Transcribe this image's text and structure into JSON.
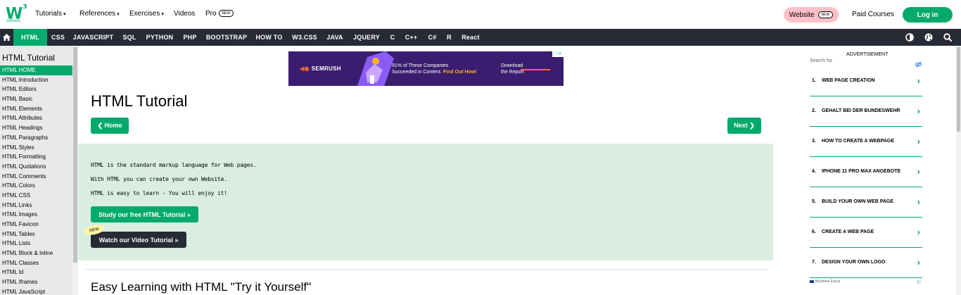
{
  "topbar": {
    "logo_main": "W",
    "logo_sup": "3",
    "logo_sub": "schools",
    "nav": [
      {
        "label": "Tutorials",
        "caret": "▾"
      },
      {
        "label": "References",
        "caret": "▾"
      },
      {
        "label": "Exercises",
        "caret": "▾"
      },
      {
        "label": "Videos"
      },
      {
        "label": "Pro",
        "badge": "NEW"
      }
    ],
    "website_label": "Website",
    "website_badge": "NEW",
    "paid_courses": "Paid Courses",
    "login": "Log in"
  },
  "navbar": {
    "tabs": [
      "HTML",
      "CSS",
      "JAVASCRIPT",
      "SQL",
      "PYTHON",
      "PHP",
      "BOOTSTRAP",
      "HOW TO",
      "W3.CSS",
      "JAVA",
      "JQUERY",
      "C",
      "C++",
      "C#",
      "R",
      "React"
    ],
    "active_tab": "HTML",
    "icons": [
      "home-icon",
      "contrast-icon",
      "globe-icon",
      "search-icon"
    ]
  },
  "sidebar": {
    "title": "HTML Tutorial",
    "links": [
      "HTML HOME",
      "HTML Introduction",
      "HTML Editors",
      "HTML Basic",
      "HTML Elements",
      "HTML Attributes",
      "HTML Headings",
      "HTML Paragraphs",
      "HTML Styles",
      "HTML Formatting",
      "HTML Quotations",
      "HTML Comments",
      "HTML Colors",
      "HTML CSS",
      "HTML Links",
      "HTML Images",
      "HTML Favicon",
      "HTML Tables",
      "HTML Lists",
      "HTML Block & Inline",
      "HTML Classes",
      "HTML Id",
      "HTML Iframes",
      "HTML JavaScript"
    ],
    "active_index": 0
  },
  "ad_banner": {
    "brand": "SEMRUSH",
    "line1": "91% of These Companies",
    "line2_prefix": "Succeeded in Content.",
    "line2_highlight": "Find Out How!",
    "cta_line1": "Download",
    "cta_line2": "the Report"
  },
  "main": {
    "title": "HTML Tutorial",
    "home_button": "❮ Home",
    "next_button": "Next ❯",
    "intro_lines": [
      "HTML is the standard markup language for Web pages.",
      "With HTML you can create your own Website.",
      "HTML is easy to learn - You will enjoy it!"
    ],
    "study_button": "Study our free HTML Tutorial »",
    "video_button": "Watch our Video Tutorial »",
    "new_tag": "NEW",
    "section_title": "Easy Learning with HTML \"Try it Yourself\""
  },
  "right_ad": {
    "label": "ADVERTISEMENT",
    "search_for": "Search for",
    "items": [
      {
        "num": "1.",
        "label": "WEB PAGE CREATION"
      },
      {
        "num": "2.",
        "label": "GEHALT BEI DER BUNDESWEHR"
      },
      {
        "num": "3.",
        "label": "HOW TO CREATE A WEBPAGE"
      },
      {
        "num": "4.",
        "label": "IPHONE 11 PRO MAX ANGEBOTE"
      },
      {
        "num": "5.",
        "label": "BUILD YOUR OWN WEB PAGE"
      },
      {
        "num": "6.",
        "label": "CREATE A WEB PAGE"
      },
      {
        "num": "7.",
        "label": "DESIGN YOUR OWN LOGO"
      }
    ],
    "footer": "Business Focus"
  },
  "colors": {
    "accent": "#04AA6D",
    "dark": "#282A35",
    "sidebar_bg": "#E7E9EB",
    "intro_bg": "#D9EEE1",
    "website_pink": "#FFC0C7",
    "new_yellow": "#FFF4A3"
  }
}
